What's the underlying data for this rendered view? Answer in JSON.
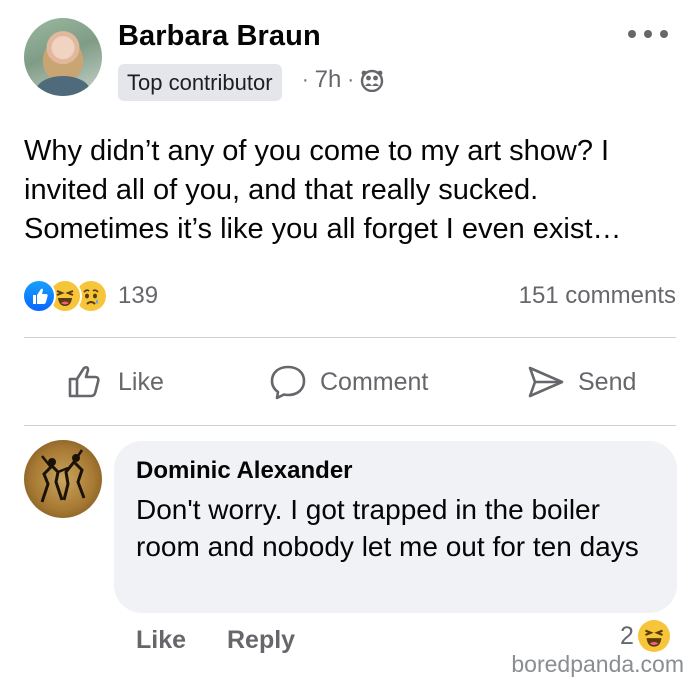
{
  "post": {
    "author": "Barbara Braun",
    "badge": "Top contributor",
    "time": "7h",
    "separator": "·",
    "privacy_icon": "friends-icon",
    "more_icon": "more-options-icon",
    "text": "Why didn’t any of you come to my art show? I invited all of you, and that really sucked. Sometimes it’s like you all forget I even exist…",
    "reactions": {
      "icons": [
        "like-icon",
        "haha-icon",
        "sad-icon"
      ],
      "count": "139"
    },
    "comments_count": "151 comments"
  },
  "actions": {
    "like_label": "Like",
    "comment_label": "Comment",
    "send_label": "Send"
  },
  "comment": {
    "author": "Dominic Alexander",
    "text": "Don't worry. I got trapped in the boiler room and nobody let me out for ten days",
    "like_label": "Like",
    "reply_label": "Reply",
    "reaction_count": "2",
    "reaction_icon": "haha-icon"
  },
  "watermark": "boredpanda.com",
  "colors": {
    "accent_blue": "#0866ff",
    "secondary_text": "#65676b",
    "bubble_bg": "#f0f2f5",
    "badge_bg": "#e4e6eb",
    "divider": "#ced0d4"
  }
}
